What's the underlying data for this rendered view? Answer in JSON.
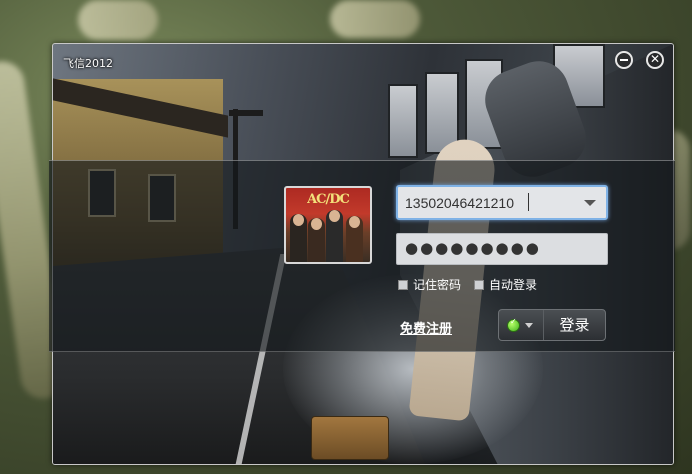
{
  "app": {
    "title": "飞信2012"
  },
  "window_controls": {
    "minimize_icon": "minimize-circle-icon",
    "close_icon": "close-circle-icon"
  },
  "avatar": {
    "logo_text": "AC/DC"
  },
  "login": {
    "account_value": "13502046421210",
    "password_mask": "●●●●●●●●●",
    "remember_password": "记住密码",
    "auto_login": "自动登录",
    "register_link": "免费注册",
    "login_button": "登录",
    "status_icon": "online-status-icon",
    "status_color": "#3fb21b",
    "input_focus_color": "#7fb2e6"
  }
}
